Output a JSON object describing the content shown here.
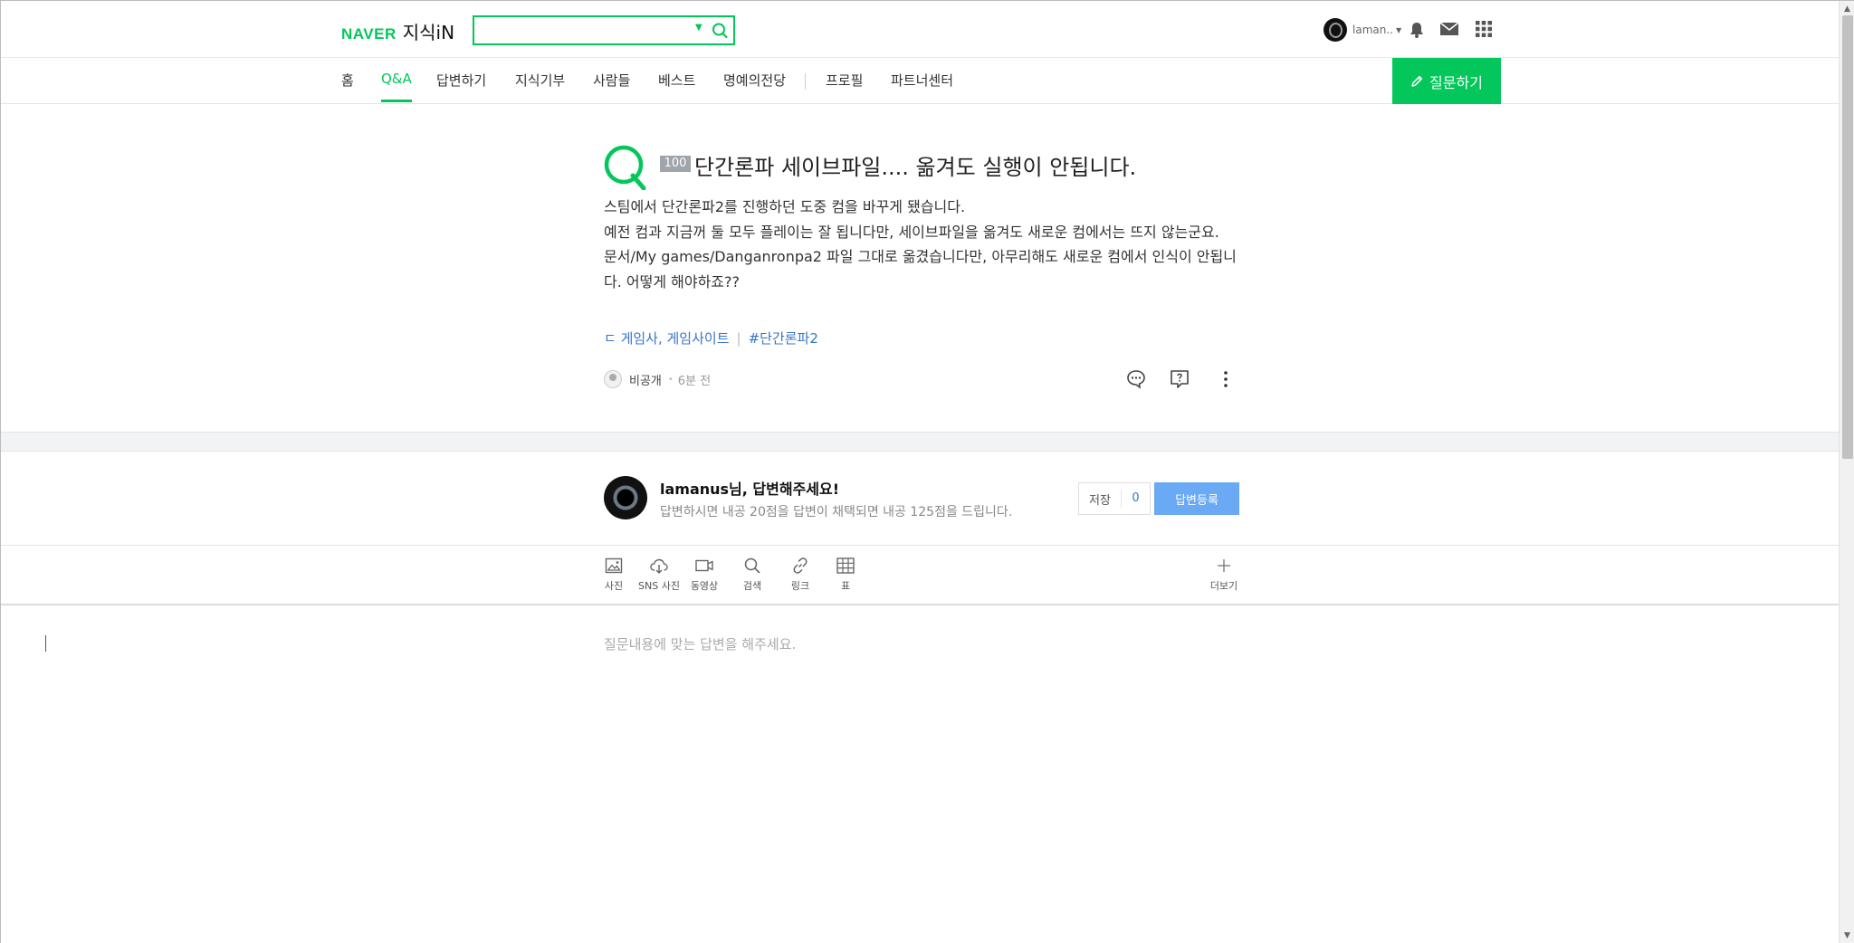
{
  "header": {
    "logo_naver": "NAVER",
    "logo_jisik": "지식iN",
    "search_placeholder": "",
    "user_name": "laman..",
    "icons": [
      "search-icon",
      "bell-icon",
      "mail-icon",
      "apps-grid-icon"
    ]
  },
  "nav": {
    "items": [
      {
        "label": "홈"
      },
      {
        "label": "Q&A",
        "active": true
      },
      {
        "label": "답변하기"
      },
      {
        "label": "지식기부"
      },
      {
        "label": "사람들"
      },
      {
        "label": "베스트"
      },
      {
        "label": "명예의전당"
      },
      {
        "label": "프로필"
      },
      {
        "label": "파트너센터"
      }
    ],
    "ask_button": "질문하기"
  },
  "question": {
    "points": "100",
    "title": "단간론파 세이브파일.... 옮겨도 실행이 안됩니다.",
    "body_lines": [
      "스팀에서 단간론파2를 진행하던 도중 컴을 바꾸게 됐습니다.",
      "예전 컴과 지금꺼 둘 모두 플레이는 잘 됩니다만, 세이브파일을 옮겨도 새로운 컴에서는 뜨지 않는군요.",
      "문서/My games/Danganronpa2 파일 그대로 옮겼습니다만, 아무리해도 새로운 컴에서 인식이 안됩니다. 어떻게 해야하죠??"
    ],
    "category": "ㄷ 게임사, 게임사이트",
    "tag": "#단간론파2",
    "author": "비공개",
    "time": "6분 전",
    "icons": [
      "comment-icon",
      "report-icon",
      "more-icon"
    ]
  },
  "answer": {
    "title": "lamanus님, 답변해주세요!",
    "subtitle": "답변하시면 내공 20점을 답변이 채택되면 내공 125점을 드립니다.",
    "save_label": "저장",
    "save_count": "0",
    "submit_label": "답변등록"
  },
  "toolbar": {
    "tools": [
      {
        "label": "사진",
        "icon": "image-icon"
      },
      {
        "label": "SNS 사진",
        "icon": "cloud-download-icon"
      },
      {
        "label": "동영상",
        "icon": "video-icon"
      },
      {
        "label": "검색",
        "icon": "search-icon"
      },
      {
        "label": "링크",
        "icon": "link-icon"
      },
      {
        "label": "표",
        "icon": "table-icon"
      }
    ],
    "more_label": "더보기"
  },
  "editor": {
    "placeholder": "질문내용에 맞는 답변을 해주세요."
  },
  "colors": {
    "brand": "#03c75a",
    "link": "#3a74c9",
    "submit": "#6aa9f3"
  }
}
